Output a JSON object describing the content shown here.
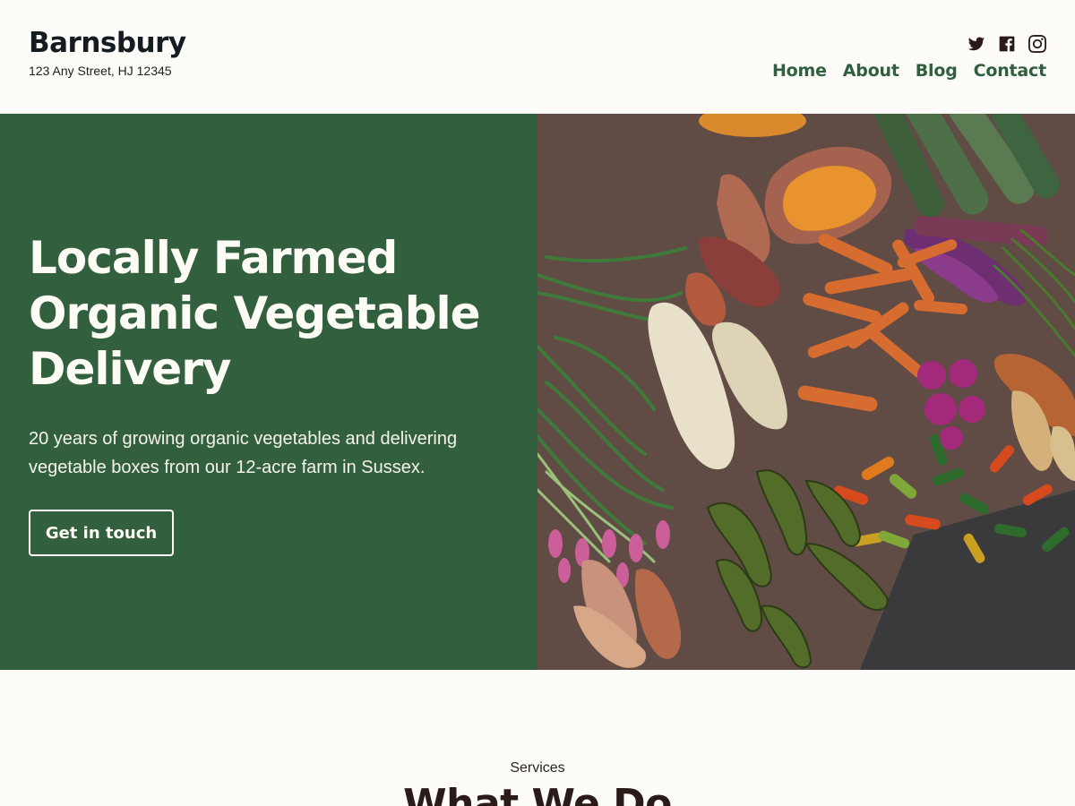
{
  "header": {
    "site_title": "Barnsbury",
    "tagline": "123 Any Street, HJ 12345",
    "social": [
      {
        "icon": "twitter-icon"
      },
      {
        "icon": "facebook-icon"
      },
      {
        "icon": "instagram-icon"
      }
    ],
    "nav": [
      "Home",
      "About",
      "Blog",
      "Contact"
    ]
  },
  "hero": {
    "title": "Locally Farmed Organic Vegetable Delivery",
    "description": "20 years of growing organic vegetables and delivering vegetable boxes from our 12-acre farm in Sussex.",
    "button_label": "Get in touch",
    "background_color": "#325f3e",
    "image_subject": "vegetables-on-burlap-photo"
  },
  "services": {
    "eyebrow": "Services",
    "heading": "What We Do"
  },
  "colors": {
    "page_bg": "#fdfcf8",
    "nav_link": "#2f5f3e",
    "hero_green": "#325f3e",
    "heading_dark": "#2a1b18"
  }
}
